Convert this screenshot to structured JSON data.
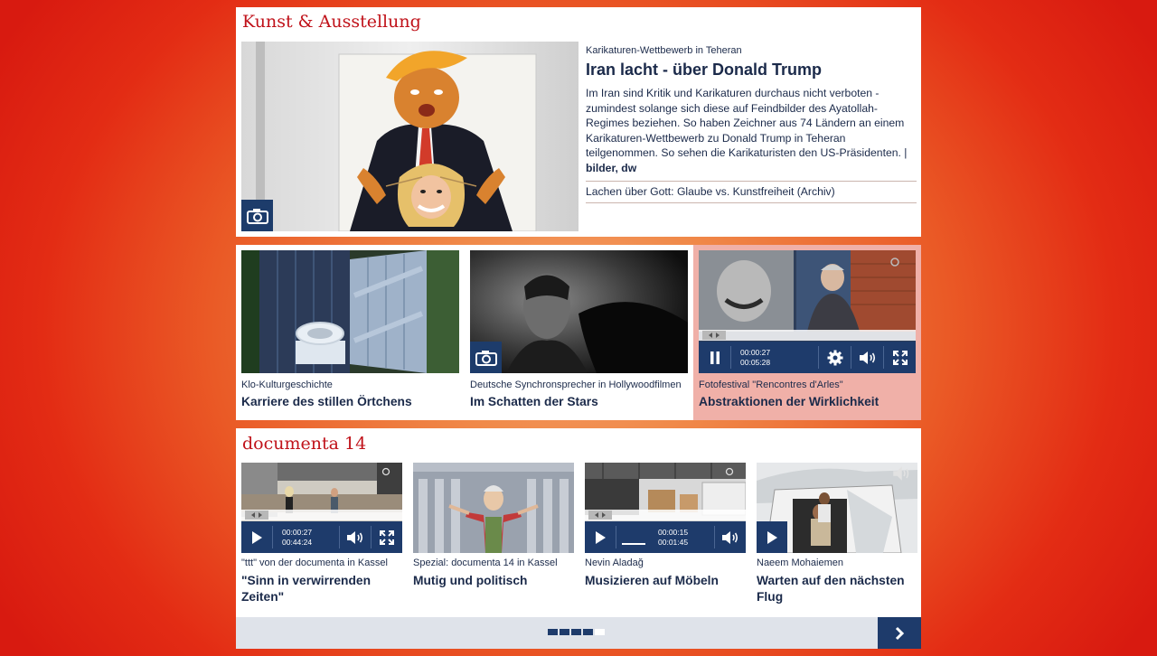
{
  "kunst": {
    "section_title": "Kunst & Ausstellung",
    "lead": {
      "kicker": "Karikaturen-Wettbewerb in Teheran",
      "headline": "Iran lacht - über Donald Trump",
      "teaser": "Im Iran sind Kritik und Karikaturen durchaus nicht verboten - zumindest solange sich diese auf Feindbilder des Ayatollah-Regimes beziehen. So haben Zeichner aus 74 Ländern an einem Karikaturen-Wettbewerb zu Donald Trump in Teheran teilgenommen. So sehen die Karikaturisten den US-Präsidenten. |",
      "teaser_link": "bilder, dw",
      "related_link": "Lachen über Gott: Glaube vs. Kunstfreiheit (Archiv)",
      "icon": "camera-icon"
    },
    "teasers": [
      {
        "kicker": "Klo-Kulturgeschichte",
        "headline": "Karriere des stillen Örtchens"
      },
      {
        "kicker": "Deutsche Synchronsprecher in Hollywoodfilmen",
        "headline": "Im Schatten der Stars",
        "icon": "camera-icon"
      },
      {
        "kicker": "Fotofestival \"Rencontres d'Arles\"",
        "headline": "Abstraktionen der Wirklichkeit",
        "player": {
          "current": "00:00:27",
          "total": "00:05:28",
          "state": "playing"
        },
        "highlight_color": "#f0b0a8"
      }
    ]
  },
  "documenta": {
    "section_title": "documenta 14",
    "items": [
      {
        "kicker": "\"ttt\" von der documenta in Kassel",
        "headline": "\"Sinn in verwirrenden Zeiten\"",
        "player": {
          "current": "00:00:27",
          "total": "00:44:24"
        }
      },
      {
        "kicker": "Spezial: documenta 14 in Kassel",
        "headline": "Mutig und politisch"
      },
      {
        "kicker": "Nevin Aladağ",
        "headline": "Musizieren auf Möbeln",
        "player": {
          "current": "00:00:15",
          "total": "00:01:45"
        }
      },
      {
        "kicker": "Naeem Mohaiemen",
        "headline": "Warten auf den nächsten Flug"
      }
    ],
    "pager": {
      "pages": 5,
      "active_page": 5
    },
    "next_icon": "chevron-right-icon"
  },
  "colors": {
    "section_title": "#c0121a",
    "navy": "#1b2a4a",
    "player_bar": "#1e3b6b",
    "highlight": "#f0b0a8",
    "pager_bar": "#dfe3ea"
  }
}
